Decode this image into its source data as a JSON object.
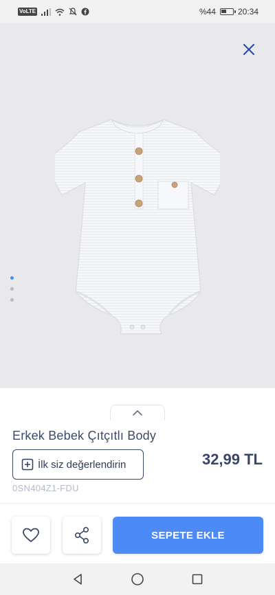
{
  "status_bar": {
    "volte": "VoLTE",
    "battery_percent": "%44",
    "battery_level": 0.44,
    "time": "20:34"
  },
  "gallery": {
    "image_count": 3,
    "active_index": 0
  },
  "product": {
    "title": "Erkek Bebek Çıtçıtlı Body",
    "rate_label": "İlk siz değerlendirin",
    "price": "32,99 TL",
    "sku": "0SN404Z1-FDU"
  },
  "actions": {
    "add_to_cart": "SEPETE EKLE"
  },
  "colors": {
    "accent": "#4c8bf5",
    "text_dark": "#3a4666",
    "sku_grey": "#b3b8c6",
    "dot_active": "#4a8cf7"
  }
}
